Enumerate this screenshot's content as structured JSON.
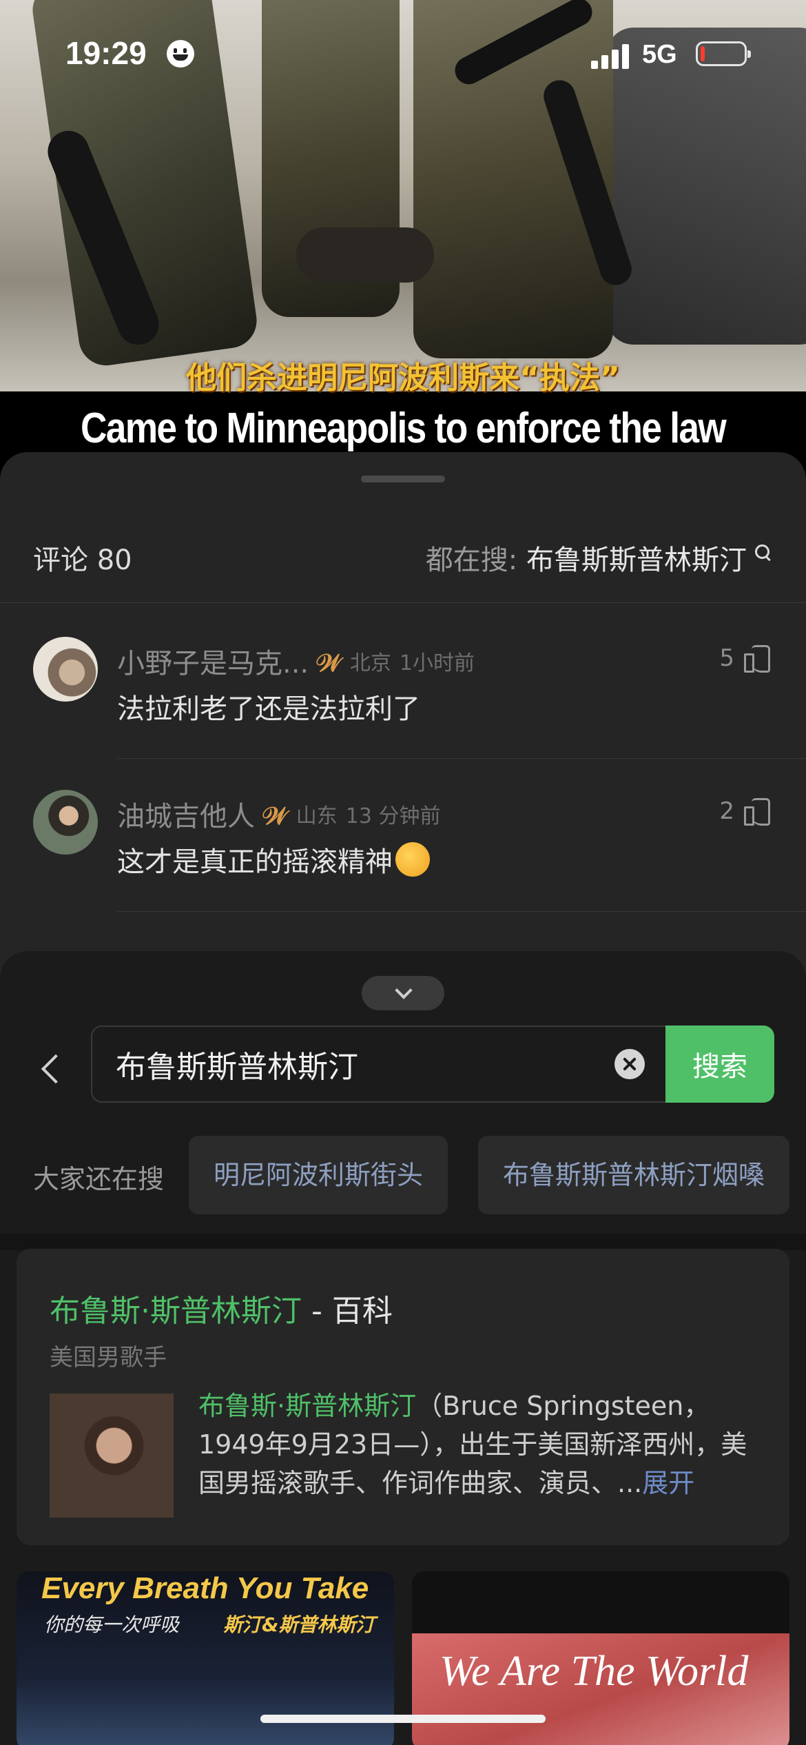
{
  "status_bar": {
    "time": "19:29",
    "network": "5G",
    "battery_level": 0.1,
    "battery_color": "#ff3b30"
  },
  "video": {
    "subtitle_cn": "他们杀进明尼阿波利斯来“执法”",
    "subtitle_en": "Came to Minneapolis to enforce the law"
  },
  "comments": {
    "header": "评论 80",
    "trending_prefix": "都在搜: ",
    "trending_query": "布鲁斯斯普林斯汀",
    "items": [
      {
        "name": "小野子是马克...",
        "vip_icon": "vip-badge-icon",
        "location": "北京",
        "time": "1小时前",
        "likes": "5",
        "text": "法拉利老了还是法拉利了"
      },
      {
        "name": "油城吉他人",
        "vip_icon": "vip-badge-icon",
        "location": "山东",
        "time": "13 分钟前",
        "likes": "2",
        "text": "这才是真正的摇滚精神"
      }
    ]
  },
  "search": {
    "query": "布鲁斯斯普林斯汀",
    "button": "搜索",
    "also_label": "大家还在搜",
    "suggestions": [
      "明尼阿波利斯街头",
      "布鲁斯斯普林斯汀烟嗓"
    ],
    "accent_color": "#4fc068"
  },
  "wiki": {
    "title_name": "布鲁斯·斯普林斯汀",
    "title_tag": " - 百科",
    "subtitle": "美国男歌手",
    "desc_name": "布鲁斯·斯普林斯汀",
    "desc_text": "（Bruce Springsteen，1949年9月23日—），出生于美国新泽西州，美国男摇滚歌手、作词作曲家、演员、...",
    "expand": "展开"
  },
  "videos": [
    {
      "title": "Every Breath You Take",
      "subtitle_cn": "你的每一次呼吸",
      "artist": "斯汀&斯普林斯汀"
    },
    {
      "title": "We Are The World"
    }
  ]
}
